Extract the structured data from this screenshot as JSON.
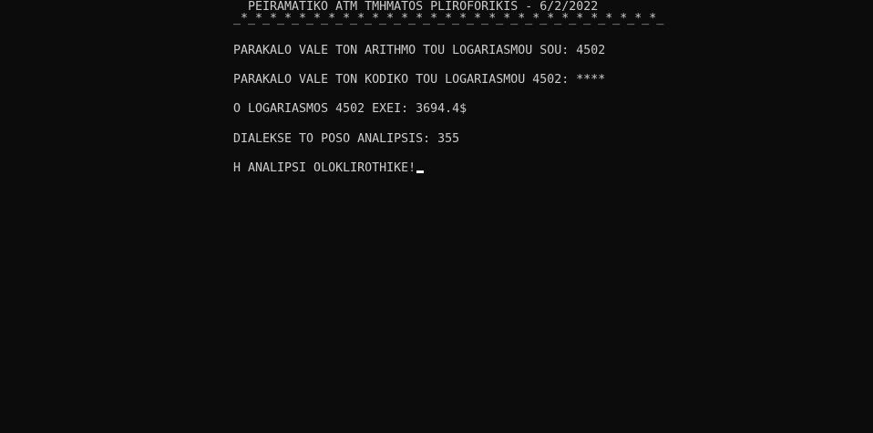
{
  "console": {
    "title": "PEIRAMATIKO ATM TMHMATOS PLIROFORIKIS - 6/2/2022",
    "separator": "_*_*_*_*_*_*_*_*_*_*_*_*_*_*_*_*_*_*_*_*_*_*_*_*_*_*_*_*_*_",
    "lines": [
      "PARAKALO VALE TON ARITHMO TOU LOGARIASMOU SOU: 4502",
      "PARAKALO VALE TON KODIKO TOU LOGARIASMOU 4502: ****",
      "O LOGARIASMOS 4502 EXEI: 3694.4$",
      "DIALEKSE TO POSO ANALIPSIS: 355",
      "H ANALIPSI OLOKLIROTHIKE!"
    ]
  },
  "colors": {
    "background": "#0c0c0c",
    "text": "#cccccc",
    "cursor": "#ffffff"
  }
}
